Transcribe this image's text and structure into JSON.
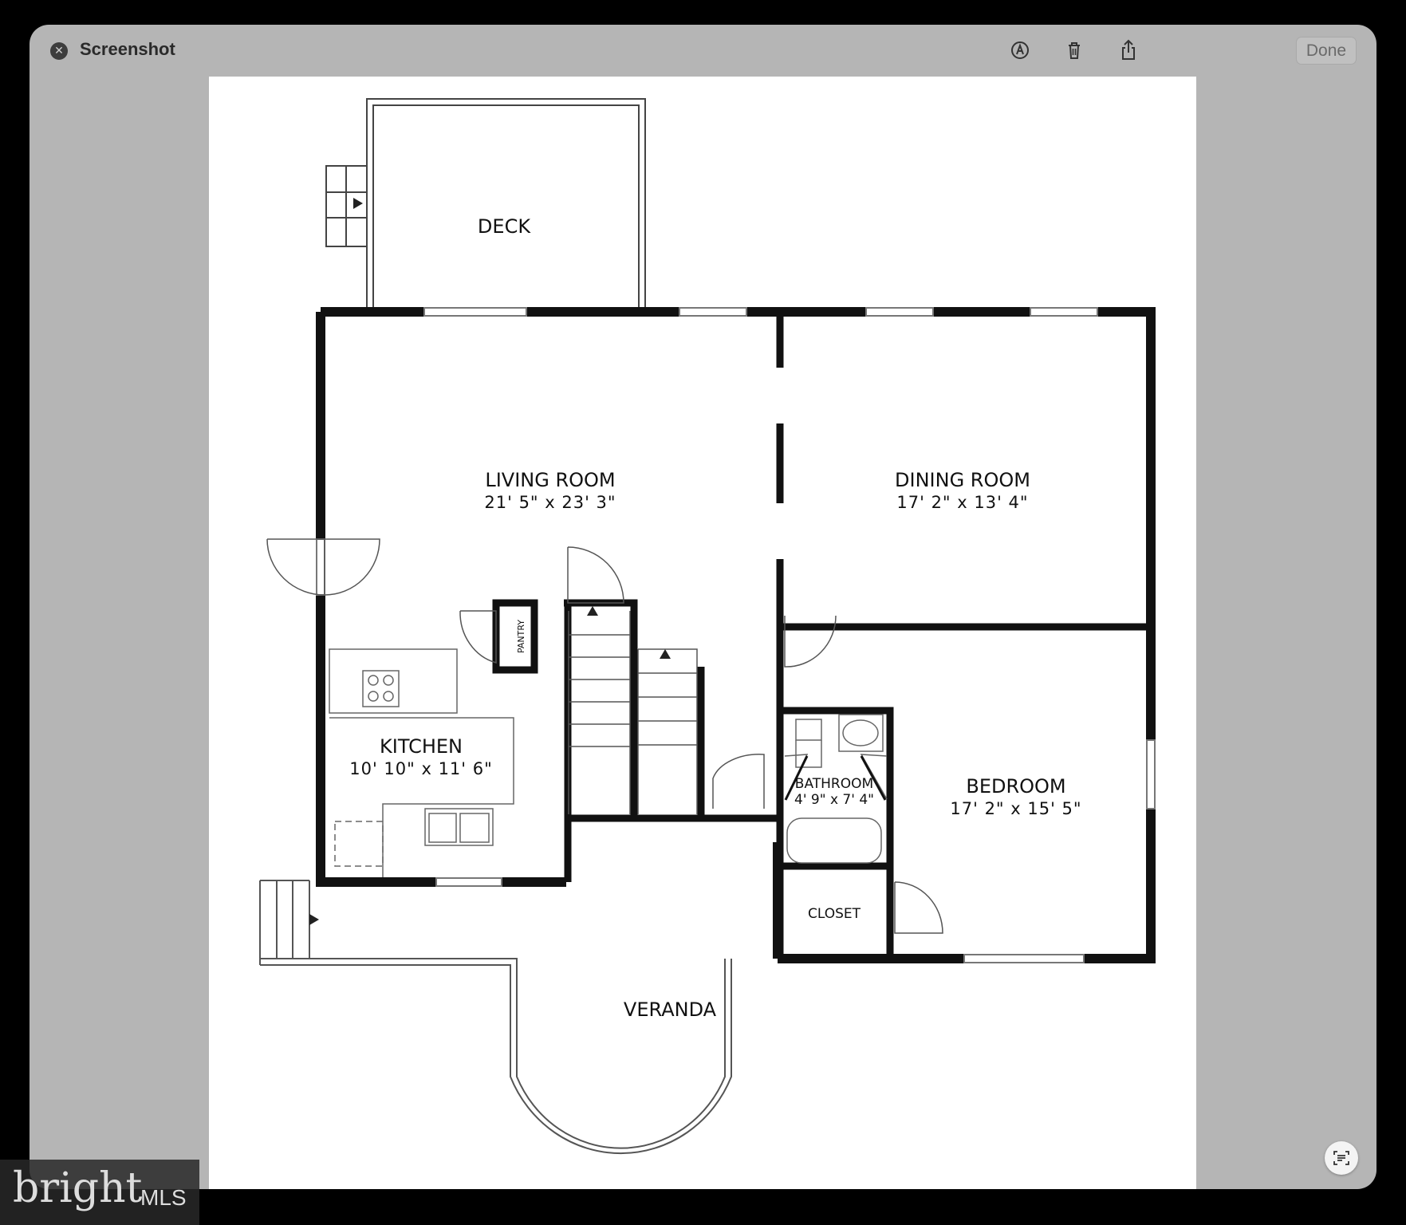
{
  "window": {
    "title": "Screenshot",
    "done_label": "Done",
    "close_icon": "close-icon",
    "markup_icon": "markup-icon",
    "trash_icon": "trash-icon",
    "share_icon": "share-icon",
    "live_text_icon": "live-text-icon"
  },
  "floorplan": {
    "rooms": [
      {
        "name": "DECK",
        "dims": ""
      },
      {
        "name": "LIVING ROOM",
        "dims": "21' 5\" x 23' 3\""
      },
      {
        "name": "DINING ROOM",
        "dims": "17' 2\" x 13' 4\""
      },
      {
        "name": "KITCHEN",
        "dims": "10' 10\" x 11' 6\""
      },
      {
        "name": "PANTRY",
        "dims": ""
      },
      {
        "name": "BATHROOM",
        "dims": "4' 9\" x 7' 4\""
      },
      {
        "name": "BEDROOM",
        "dims": "17' 2\" x 15' 5\""
      },
      {
        "name": "CLOSET",
        "dims": ""
      },
      {
        "name": "VERANDA",
        "dims": ""
      }
    ]
  },
  "watermark": {
    "brand": "bright",
    "suffix": "MLS"
  },
  "colors": {
    "window_bg": "#b5b5b5",
    "page_bg": "#ffffff",
    "wall": "#111111"
  }
}
